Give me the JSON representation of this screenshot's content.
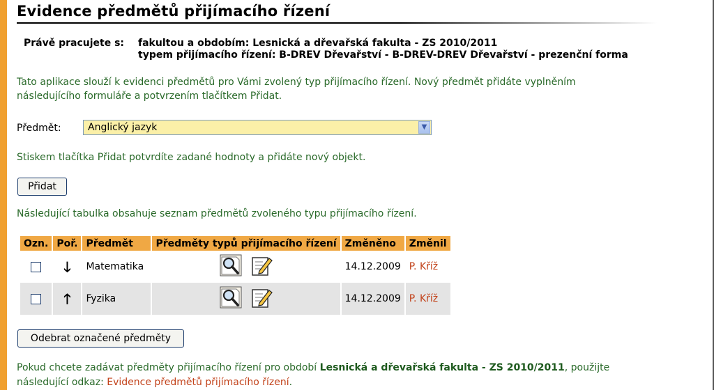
{
  "page": {
    "title": "Evidence předmětů přijímacího řízení"
  },
  "context": {
    "label": "Právě pracujete s:",
    "line1": "fakultou a obdobím: Lesnická a dřevařská fakulta - ZS 2010/2011",
    "line2": "typem přijímacího řízení: B-DREV Dřevařství - B-DREV-DREV Dřevařství - prezenční forma"
  },
  "intro": {
    "text_line1": "Tato aplikace slouží k evidenci předmětů pro Vámi zvolený typ přijímacího řízení. Nový předmět přidáte vyplněním",
    "text_line2": "následujícího formuláře a potvrzením tlačítkem Přidat."
  },
  "form": {
    "subject_label": "Předmět:",
    "subject_value": "Anglický jazyk",
    "hint": "Stiskem tlačítka Přidat potvrdíte zadané hodnoty a přidáte nový objekt.",
    "add_button": "Přidat"
  },
  "table": {
    "caption": "Následující tabulka obsahuje seznam předmětů zvoleného typu přijímacího řízení.",
    "headers": [
      "Ozn.",
      "Poř.",
      "Předmět",
      "Předměty typů přijímacího řízení",
      "Změněno",
      "Změnil"
    ],
    "rows": [
      {
        "order_icon": "arrow-down",
        "order_glyph": "🡓",
        "subject": "Matematika",
        "changed": "14.12.2009",
        "changed_by": "P. Kříž"
      },
      {
        "order_icon": "arrow-up",
        "order_glyph": "🡑",
        "subject": "Fyzika",
        "changed": "14.12.2009",
        "changed_by": "P. Kříž"
      }
    ],
    "remove_button": "Odebrat označené předměty"
  },
  "footer": {
    "text_before": "Pokud chcete zadávat předměty přijímacího řízení pro období ",
    "period": "Lesnická a dřevařská fakulta - ZS 2010/2011",
    "text_after": ", použijte",
    "text_line2": "následující odkaz: ",
    "link": "Evidence předmětů přijímacího řízení",
    "link_tail": "."
  },
  "colors": {
    "accent": "#f0a844",
    "text_green": "#2a6a2a",
    "link_red": "#c2421a",
    "select_bg": "#fbf0a8"
  }
}
